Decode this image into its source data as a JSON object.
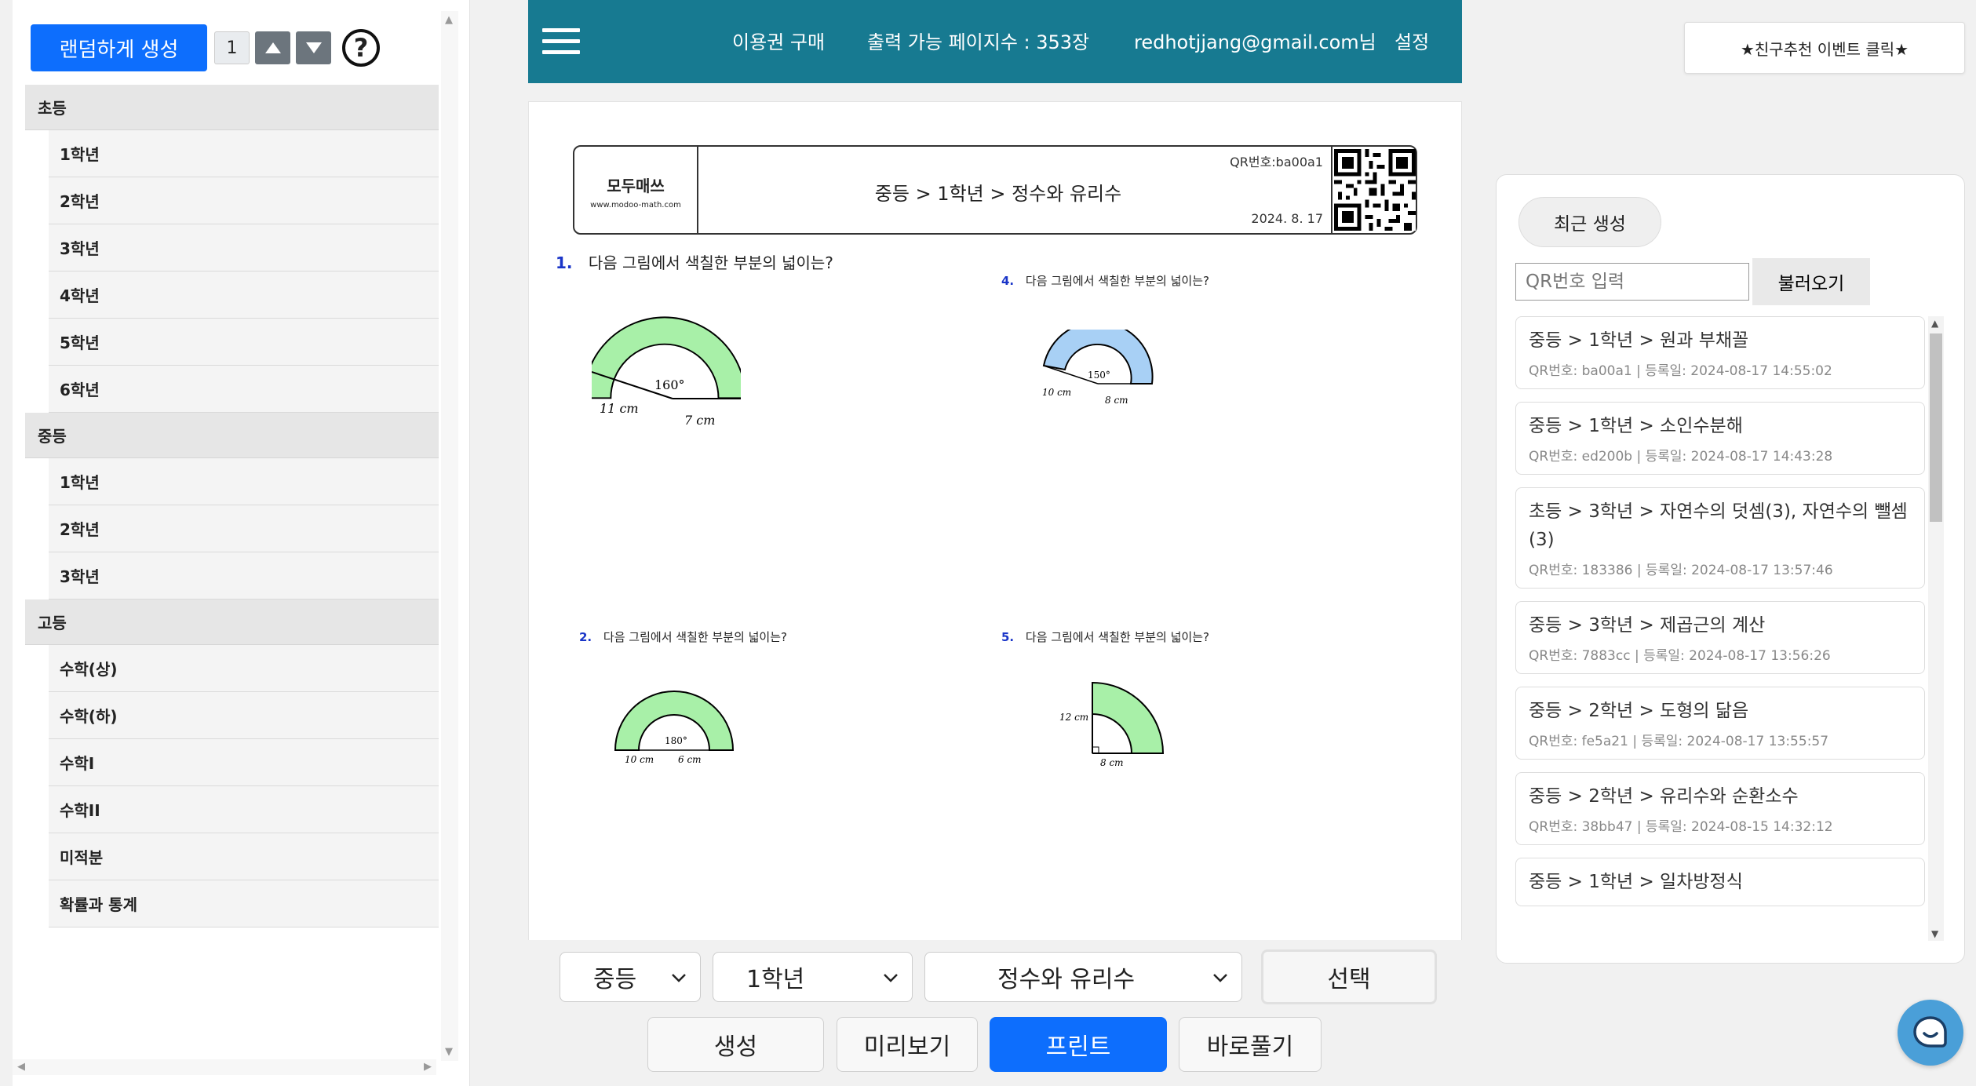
{
  "left": {
    "random_label": "랜덤하게 생성",
    "count": "1",
    "up_glyph": "▲",
    "down_glyph": "▼",
    "help_glyph": "?",
    "categories": [
      {
        "header": "초등",
        "items": [
          "1학년",
          "2학년",
          "3학년",
          "4학년",
          "5학년",
          "6학년"
        ]
      },
      {
        "header": "중등",
        "items": [
          "1학년",
          "2학년",
          "3학년"
        ]
      },
      {
        "header": "고등",
        "items": [
          "수학(상)",
          "수학(하)",
          "수학I",
          "수학II",
          "미적분",
          "확률과 통계"
        ]
      }
    ]
  },
  "nav": {
    "purchase": "이용권 구매",
    "pages": "출력 가능 페이지수 : 353장",
    "user": "redhotjjang@gmail.com님",
    "settings": "설정"
  },
  "worksheet": {
    "logo_title": "모두매쓰",
    "logo_url": "www.modoo-math.com",
    "title": "중등 > 1학년 > 정수와 유리수",
    "qr_label": "QR번호:ba00a1",
    "date": "2024. 8. 17",
    "questions": [
      {
        "num": "1.",
        "text": "다음 그림에서 색칠한 부분의 넓이는?",
        "angle": "160°",
        "r1": "11 cm",
        "r2": "7 cm",
        "color": "#a8f0a8"
      },
      {
        "num": "4.",
        "text": "다음 그림에서 색칠한 부분의 넓이는?",
        "angle": "150°",
        "r1": "10 cm",
        "r2": "8 cm",
        "color": "#a8d0f5"
      },
      {
        "num": "2.",
        "text": "다음 그림에서 색칠한 부분의 넓이는?",
        "angle": "180°",
        "r1": "10 cm",
        "r2": "6 cm",
        "color": "#a8f0a8"
      },
      {
        "num": "5.",
        "text": "다음 그림에서 색칠한 부분의 넓이는?",
        "r1": "12 cm",
        "r2": "8 cm",
        "color": "#a8f0a8"
      }
    ]
  },
  "bottom": {
    "level": "중등",
    "grade": "1학년",
    "unit": "정수와 유리수",
    "select": "선택",
    "generate": "생성",
    "preview": "미리보기",
    "print": "프린트",
    "solve": "바로풀기"
  },
  "right": {
    "invite": "★친구추천 이벤트 클릭★",
    "recent_tab": "최근 생성",
    "qr_placeholder": "QR번호 입력",
    "load": "불러오기",
    "recent": [
      {
        "title": "중등 > 1학년 > 원과 부채꼴",
        "meta": "QR번호: ba00a1 | 등록일: 2024-08-17 14:55:02"
      },
      {
        "title": "중등 > 1학년 > 소인수분해",
        "meta": "QR번호: ed200b | 등록일: 2024-08-17 14:43:28"
      },
      {
        "title": "초등 > 3학년 > 자연수의 덧셈(3), 자연수의 뺄셈(3)",
        "meta": "QR번호: 183386 | 등록일: 2024-08-17 13:57:46"
      },
      {
        "title": "중등 > 3학년 > 제곱근의 계산",
        "meta": "QR번호: 7883cc | 등록일: 2024-08-17 13:56:26"
      },
      {
        "title": "중등 > 2학년 > 도형의 닮음",
        "meta": "QR번호: fe5a21 | 등록일: 2024-08-17 13:55:57"
      },
      {
        "title": "중등 > 2학년 > 유리수와 순환소수",
        "meta": "QR번호: 38bb47 | 등록일: 2024-08-15 14:32:12"
      },
      {
        "title": "중등 > 1학년 > 일차방정식",
        "meta": ""
      }
    ]
  },
  "colors": {
    "nav_bg": "#177a91",
    "primary": "#0d6efd",
    "question_num": "#1a35c8"
  }
}
